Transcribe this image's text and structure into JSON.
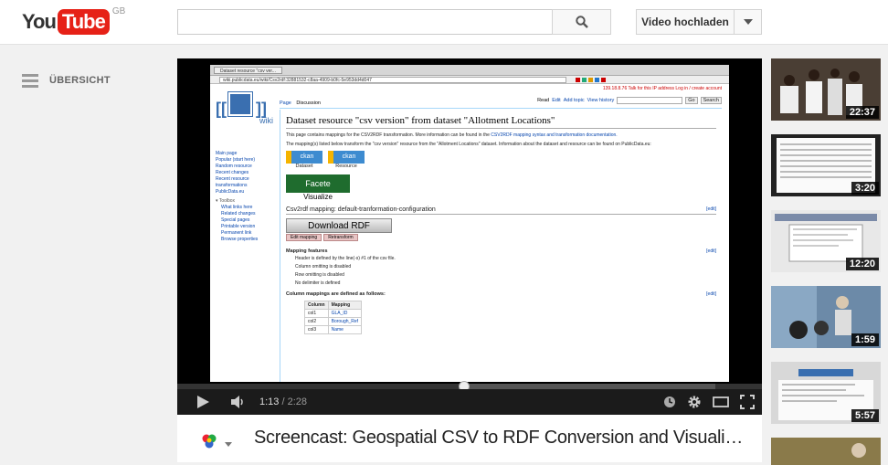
{
  "header": {
    "logo_you": "You",
    "logo_tube": "Tube",
    "region": "GB",
    "search_placeholder": "",
    "upload_label": "Video hochladen"
  },
  "guide": {
    "label": "ÜBERSICHT"
  },
  "video_frame": {
    "browser_tab": "Dataset resource \"csv ver...",
    "url": "wiki.publicdata.eu/wiki/Csv2rdf:32881532-c8aa-4909-b0fc-5e953dd4d047",
    "ip_note": "139.18.8.76  Talk for this IP address  Log in / create account",
    "tab_page": "Page",
    "tab_discussion": "Discussion",
    "tab_read": "Read",
    "tab_edit": "Edit",
    "tab_add_topic": "Add topic",
    "tab_view_history": "View history",
    "btn_go": "Go",
    "btn_search": "Search",
    "wiki_word": "wiki",
    "page_title": "Dataset resource \"csv version\" from dataset \"Allotment Locations\"",
    "intro": "This page contains mappings for the CSV2RDF transformation. More information can be found in the",
    "intro_link": "CSV2RDF mapping syntax and transformation documentation.",
    "desc": "The mapping(s) listed below transform the \"csv version\" resource from the \"Allotment Locations\" dataset. Information about the dataset and resource can be found on PublicData.eu:",
    "ckan_dataset_img": "ckan",
    "ckan_dataset": "Dataset",
    "ckan_resource_img": "ckan",
    "ckan_resource": "Resource",
    "facete_img": "Facete",
    "facete": "Visualize",
    "mapping_heading": "Csv2rdf mapping: default-tranformation-configuration",
    "edit": "[edit]",
    "download": "Download RDF",
    "edit_mapping": "Edit mapping",
    "retransform": "Retransform",
    "features_heading": "Mapping features",
    "features": [
      "Header is defined by the line(-s) #1 of the csv file.",
      "Column omitting is disabled",
      "Row omitting is disabled",
      "No delimiter is defined"
    ],
    "columns_heading": "Column mappings are defined as follows:",
    "col_header": [
      "Column",
      "Mapping"
    ],
    "rows": [
      [
        "col1",
        "GLA_ID"
      ],
      [
        "col2",
        "Borough_Ref"
      ],
      [
        "col3",
        "Name"
      ]
    ],
    "nav": [
      "Main page",
      "Popular (start here)",
      "Random resource",
      "Recent changes",
      "Recent resource transformations",
      "PublicData.eu"
    ],
    "toolbox": "Toolbox",
    "toolbox_items": [
      "What links here",
      "Related changes",
      "Special pages",
      "Printable version",
      "Permanent link",
      "Browse properties"
    ]
  },
  "player": {
    "current_time": "1:13",
    "separator": " / ",
    "total_time": "2:28",
    "progress": 0.49,
    "buffered": 0.92
  },
  "video": {
    "title": "Screencast: Geospatial CSV to RDF Conversion and Visualization"
  },
  "related": [
    {
      "duration": "22:37"
    },
    {
      "duration": "3:20"
    },
    {
      "duration": "12:20"
    },
    {
      "duration": "1:59"
    },
    {
      "duration": "5:57"
    },
    {
      "duration": ""
    }
  ]
}
